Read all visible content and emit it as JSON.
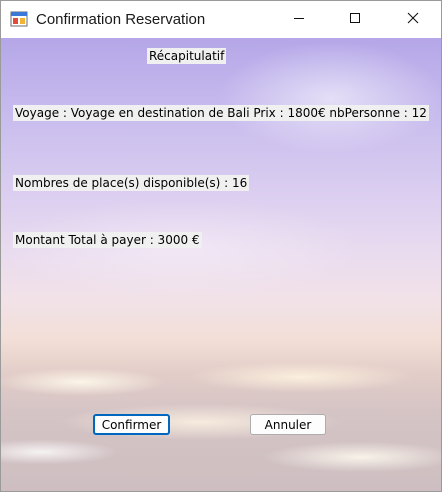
{
  "window": {
    "title": "Confirmation Reservation",
    "icons": {
      "app": "windows-form-icon",
      "minimize": "minimize-icon",
      "maximize": "maximize-icon",
      "close": "close-icon"
    }
  },
  "form": {
    "recap_label": "Récapitulatif",
    "voyage_label": "Voyage : Voyage en destination de Bali Prix : 1800€  nbPersonne :  12",
    "places_label": "Nombres de place(s) disponible(s) : 16",
    "montant_label": "Montant Total à payer : 3000 €"
  },
  "buttons": {
    "confirm_label": "Confirmer",
    "cancel_label": "Annuler"
  },
  "colors": {
    "accent": "#0067c0",
    "label_background": "#f0f0f0"
  }
}
